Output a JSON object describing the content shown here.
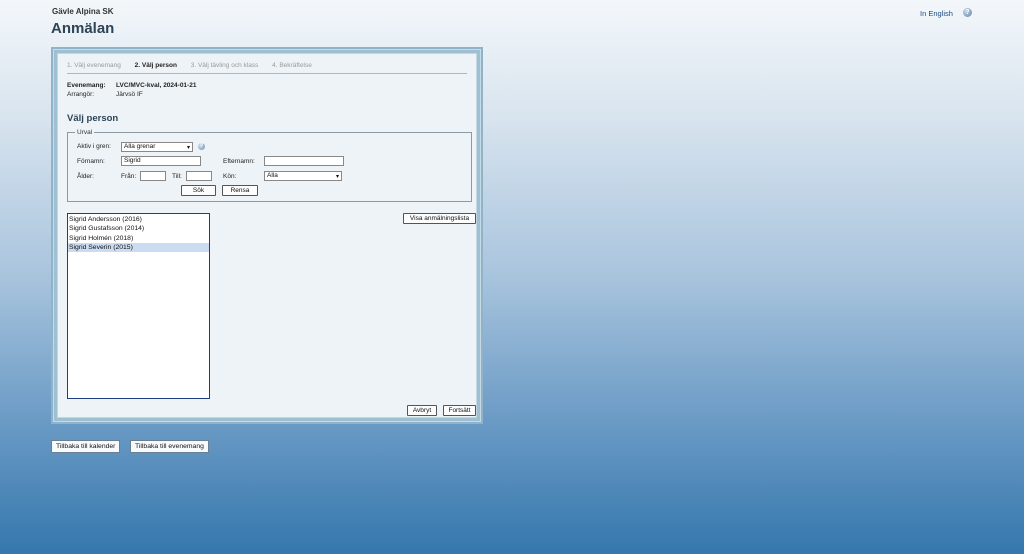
{
  "header": {
    "club": "Gävle Alpina SK",
    "title": "Anmälan",
    "language_link": "In English",
    "help_icon": "help-icon"
  },
  "steps": [
    {
      "label": "1. Välj evenemang",
      "active": false
    },
    {
      "label": "2. Välj person",
      "active": true
    },
    {
      "label": "3. Välj tävling och klass",
      "active": false
    },
    {
      "label": "4. Bekräftelse",
      "active": false
    }
  ],
  "event": {
    "event_label": "Evenemang:",
    "event_value": "LVC/MVC-kval, 2024-01-21",
    "organizer_label": "Arrangör:",
    "organizer_value": "Järvsö IF"
  },
  "section_title": "Välj person",
  "filter": {
    "legend": "Urval",
    "branch_label": "Aktiv i gren:",
    "branch_value": "Alla grenar",
    "firstname_label": "Förnamn:",
    "firstname_value": "Sigrid",
    "lastname_label": "Efternamn:",
    "lastname_value": "",
    "age_label": "Ålder:",
    "from_label": "Från:",
    "from_value": "",
    "to_label": "Till:",
    "to_value": "",
    "gender_label": "Kön:",
    "gender_value": "Alla",
    "search_button": "Sök",
    "clear_button": "Rensa"
  },
  "results": [
    {
      "name": "Sigrid Andersson (2016)",
      "selected": false
    },
    {
      "name": "Sigrid Gustafsson (2014)",
      "selected": false
    },
    {
      "name": "Sigrid Holmén (2018)",
      "selected": false
    },
    {
      "name": "Sigrid Severin (2015)",
      "selected": true
    }
  ],
  "actions": {
    "show_list": "Visa anmälningslista",
    "cancel": "Avbryt",
    "continue": "Fortsätt"
  },
  "footer": {
    "back_calendar": "Tillbaka till kalender",
    "back_events": "Tillbaka till evenemang"
  }
}
